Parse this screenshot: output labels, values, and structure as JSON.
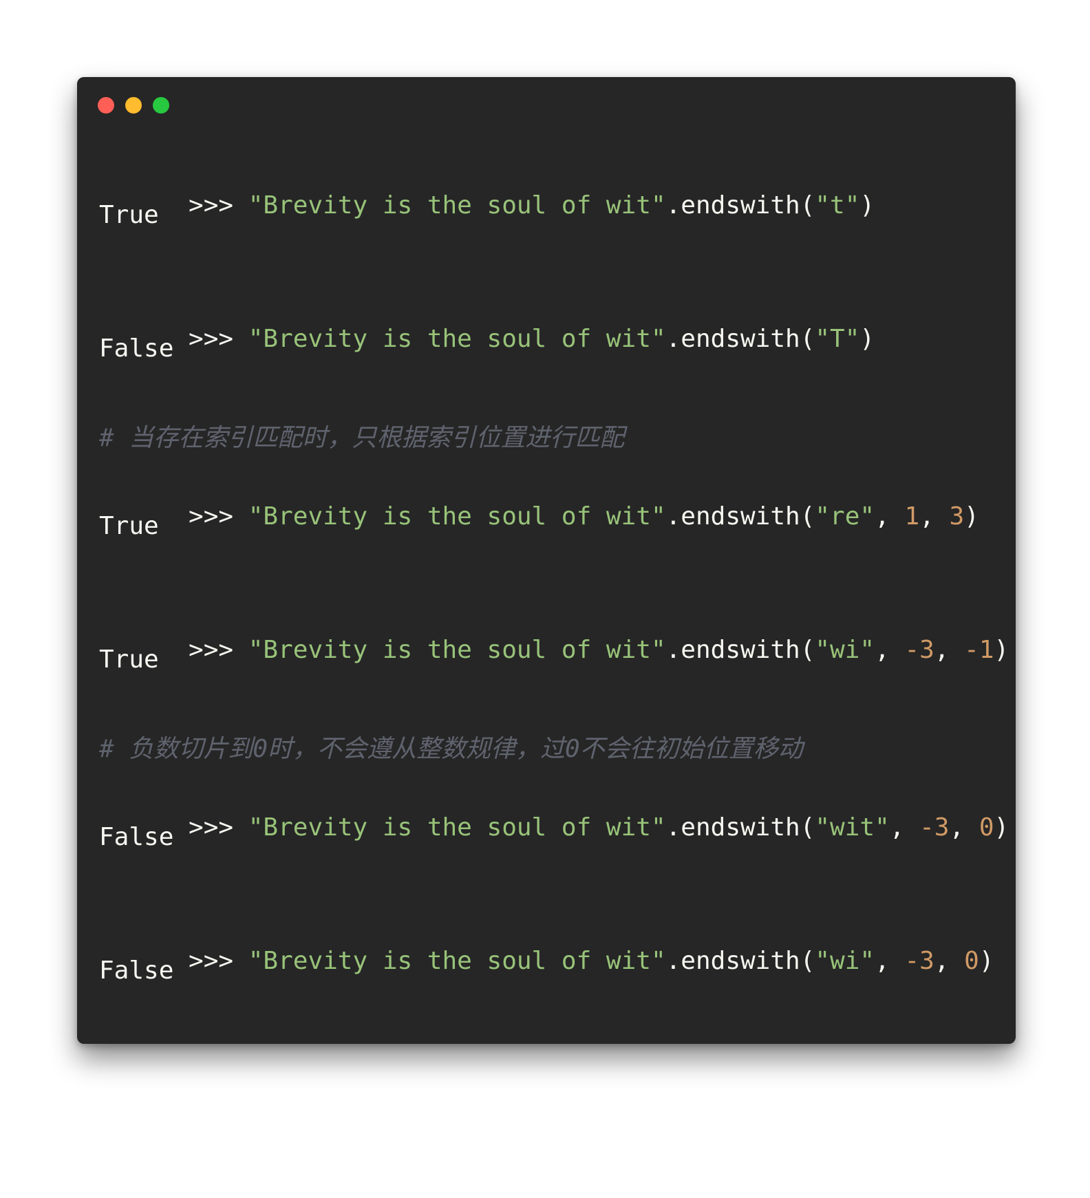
{
  "window": {
    "controls": {
      "close_color": "#ff5f57",
      "minimize_color": "#febc2e",
      "zoom_color": "#28c840"
    }
  },
  "lines": [
    {
      "kind": "code",
      "prompt": ">>> ",
      "str": "\"Brevity is the soul of wit\"",
      "method": ".endswith(",
      "args": [
        {
          "t": "str",
          "v": "\"t\""
        }
      ],
      "close": ")"
    },
    {
      "kind": "output",
      "text": "True"
    },
    {
      "kind": "code",
      "prompt": ">>> ",
      "str": "\"Brevity is the soul of wit\"",
      "method": ".endswith(",
      "args": [
        {
          "t": "str",
          "v": "\"T\""
        }
      ],
      "close": ")"
    },
    {
      "kind": "output",
      "text": "False"
    },
    {
      "kind": "comment",
      "text": "# 当存在索引匹配时，只根据索引位置进行匹配"
    },
    {
      "kind": "code",
      "prompt": ">>> ",
      "str": "\"Brevity is the soul of wit\"",
      "method": ".endswith(",
      "args": [
        {
          "t": "str",
          "v": "\"re\""
        },
        {
          "t": "sep",
          "v": ", "
        },
        {
          "t": "num",
          "v": "1"
        },
        {
          "t": "sep",
          "v": ", "
        },
        {
          "t": "num",
          "v": "3"
        }
      ],
      "close": ")"
    },
    {
      "kind": "output",
      "text": "True"
    },
    {
      "kind": "code",
      "prompt": ">>> ",
      "str": "\"Brevity is the soul of wit\"",
      "method": ".endswith(",
      "args": [
        {
          "t": "str",
          "v": "\"wi\""
        },
        {
          "t": "sep",
          "v": ", "
        },
        {
          "t": "num",
          "v": "-3"
        },
        {
          "t": "sep",
          "v": ", "
        },
        {
          "t": "num",
          "v": "-1"
        }
      ],
      "close": ")"
    },
    {
      "kind": "output",
      "text": "True"
    },
    {
      "kind": "comment",
      "text": "# 负数切片到0时，不会遵从整数规律，过0不会往初始位置移动"
    },
    {
      "kind": "code",
      "prompt": ">>> ",
      "str": "\"Brevity is the soul of wit\"",
      "method": ".endswith(",
      "args": [
        {
          "t": "str",
          "v": "\"wit\""
        },
        {
          "t": "sep",
          "v": ", "
        },
        {
          "t": "num",
          "v": "-3"
        },
        {
          "t": "sep",
          "v": ", "
        },
        {
          "t": "num",
          "v": "0"
        }
      ],
      "close": ")"
    },
    {
      "kind": "output",
      "text": "False"
    },
    {
      "kind": "code",
      "prompt": ">>> ",
      "str": "\"Brevity is the soul of wit\"",
      "method": ".endswith(",
      "args": [
        {
          "t": "str",
          "v": "\"wi\""
        },
        {
          "t": "sep",
          "v": ", "
        },
        {
          "t": "num",
          "v": "-3"
        },
        {
          "t": "sep",
          "v": ", "
        },
        {
          "t": "num",
          "v": "0"
        }
      ],
      "close": ")"
    },
    {
      "kind": "output",
      "text": "False"
    }
  ]
}
